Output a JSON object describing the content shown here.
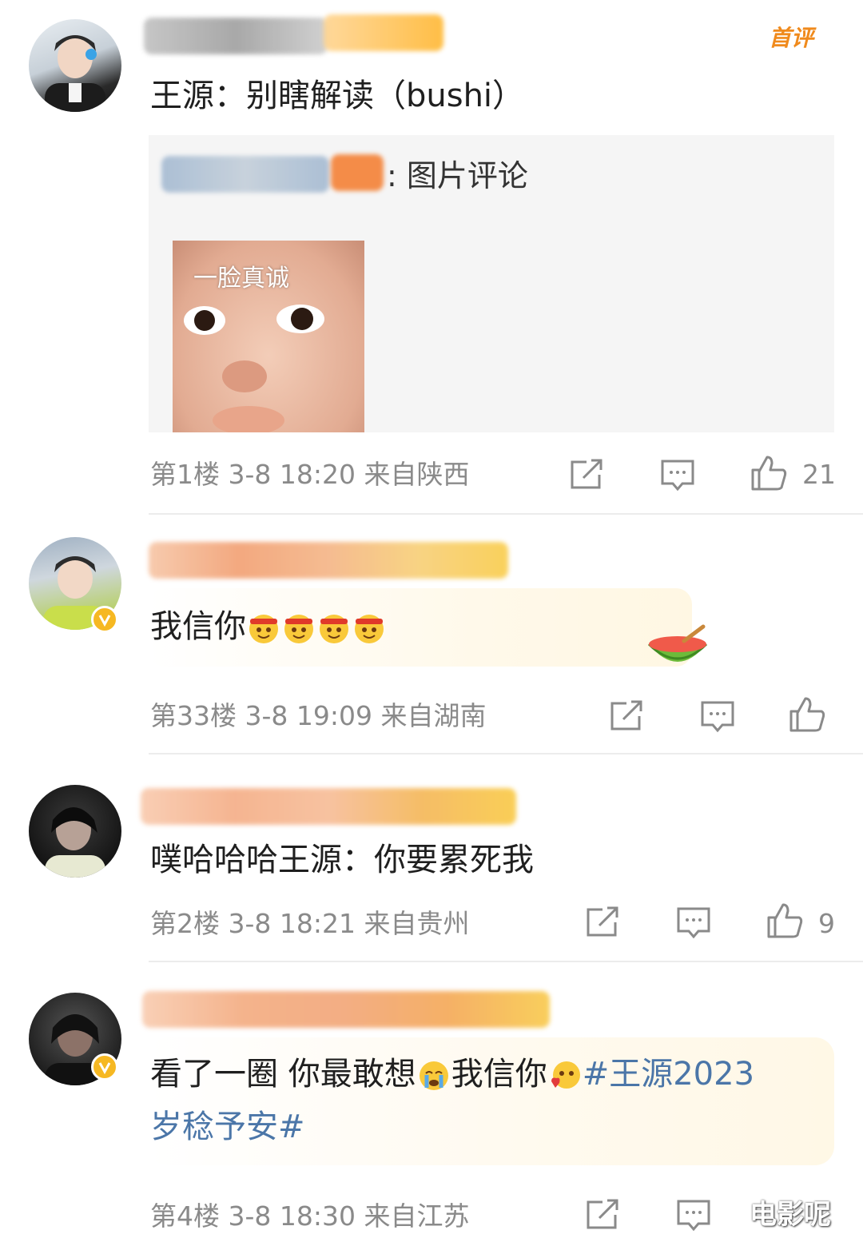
{
  "comments": [
    {
      "text": "王源：别瞎解读（bushi）",
      "badge": "首评",
      "quote": {
        "suffix": ": 图片评论",
        "image_caption": "一脸真诚"
      },
      "meta": "第1楼  3-8 18:20  来自陕西",
      "likes": "21"
    },
    {
      "text": "我信你",
      "emoji_count": 4,
      "meta": "第33楼  3-8 19:09  来自湖南",
      "likes": ""
    },
    {
      "text": "噗哈哈哈王源：你要累死我",
      "meta": "第2楼  3-8 18:21  来自贵州",
      "likes": "9"
    },
    {
      "text_part1": "看了一圈 你最敢想",
      "text_part2": "我信你",
      "hashtag_line1": "#王源2023",
      "hashtag_line2": "岁稔予安#",
      "meta": "第4楼  3-8 18:30  来自江苏",
      "likes": ""
    }
  ],
  "watermark": "电影呢",
  "colors": {
    "hashtag": "#4b76a8",
    "badge": "#f08a1c",
    "meta": "#8a8a8a",
    "verified": "#f6b822"
  },
  "icons": [
    "repost-icon",
    "comment-icon",
    "like-icon"
  ]
}
